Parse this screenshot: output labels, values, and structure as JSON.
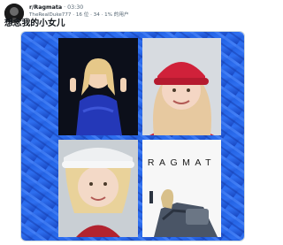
{
  "post": {
    "username": "r/Ragmata",
    "timestamp": "· 03:30",
    "sub_handle": "TheRealDuke777",
    "sub_meta": "· 16 位 · 34 · 1% 的用户",
    "text": "想念我的小女儿"
  },
  "media": {
    "logo_text": "RAGMAT",
    "frame_color": "#2458d8",
    "photos": [
      {
        "name": "girl-blue-jacket-peace-sign"
      },
      {
        "name": "girl-red-hat-smiling"
      },
      {
        "name": "girl-white-hat-close-up"
      },
      {
        "name": "ragmata-character-crouching"
      }
    ]
  }
}
